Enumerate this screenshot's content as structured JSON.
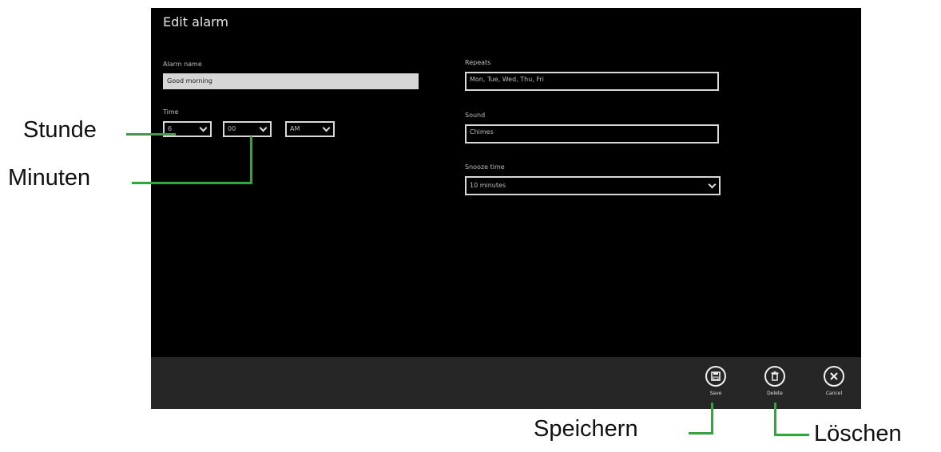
{
  "window": {
    "title": "Edit alarm"
  },
  "alarm_name": {
    "label": "Alarm name",
    "value": "Good morning"
  },
  "time": {
    "label": "Time",
    "hour": "6",
    "minute": "00",
    "period": "AM"
  },
  "repeats": {
    "label": "Repeats",
    "value": "Mon, Tue, Wed, Thu, Fri"
  },
  "sound": {
    "label": "Sound",
    "value": "Chimes"
  },
  "snooze": {
    "label": "Snooze time",
    "value": "10 minutes"
  },
  "app_bar": {
    "save": "Save",
    "delete": "Delete",
    "cancel": "Cancel"
  },
  "callouts": {
    "stunde": "Stunde",
    "minuten": "Minuten",
    "speichern": "Speichern",
    "loeschen": "Löschen"
  },
  "colors": {
    "screen_bg": "#000000",
    "app_bar_bg": "#262626",
    "callout_line": "#3aa043"
  }
}
